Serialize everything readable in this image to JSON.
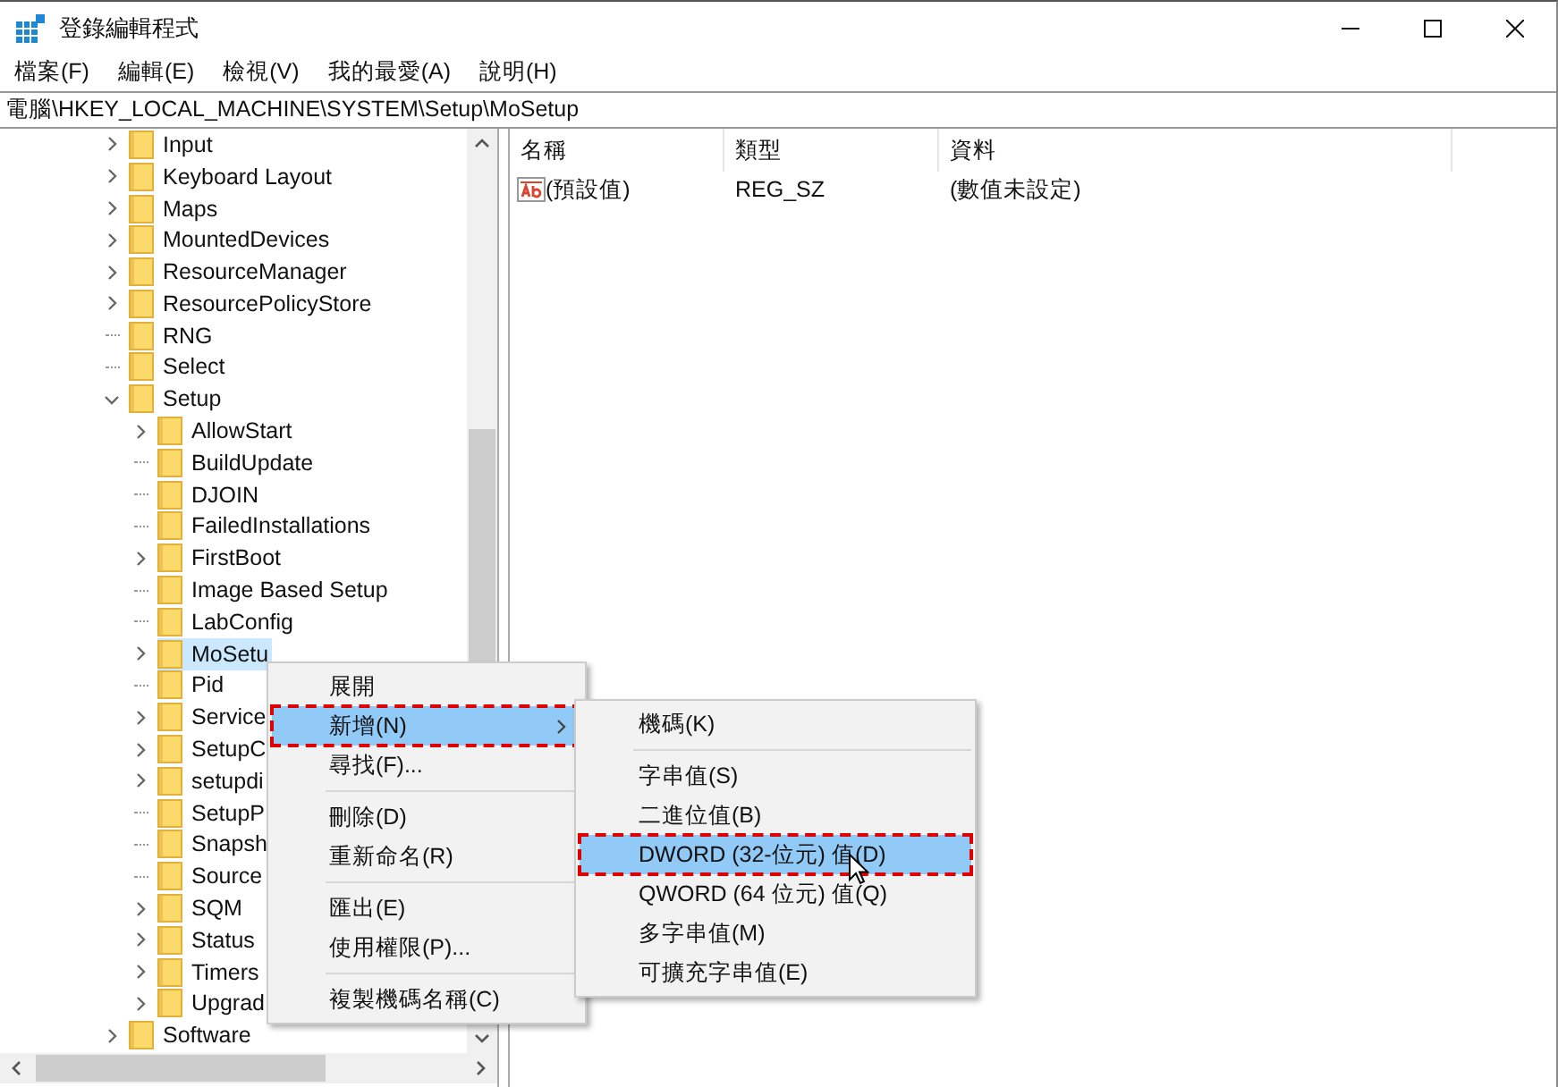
{
  "window": {
    "title": "登錄編輯程式"
  },
  "menu": [
    "檔案(F)",
    "編輯(E)",
    "檢視(V)",
    "我的最愛(A)",
    "說明(H)"
  ],
  "address": "電腦\\HKEY_LOCAL_MACHINE\\SYSTEM\\Setup\\MoSetup",
  "tree": [
    {
      "label": "Input",
      "has_children": true,
      "expanded": false,
      "selected": false
    },
    {
      "label": "Keyboard Layout",
      "has_children": true,
      "expanded": false,
      "selected": false
    },
    {
      "label": "Maps",
      "has_children": true,
      "expanded": false,
      "selected": false
    },
    {
      "label": "MountedDevices",
      "has_children": true,
      "expanded": false,
      "selected": false
    },
    {
      "label": "ResourceManager",
      "has_children": true,
      "expanded": false,
      "selected": false
    },
    {
      "label": "ResourcePolicyStore",
      "has_children": true,
      "expanded": false,
      "selected": false
    },
    {
      "label": "RNG",
      "has_children": false,
      "selected": false
    },
    {
      "label": "Select",
      "has_children": false,
      "selected": false
    },
    {
      "label": "Setup",
      "has_children": true,
      "expanded": true,
      "selected": false,
      "children": [
        {
          "label": "AllowStart",
          "has_children": true,
          "expanded": false,
          "selected": false
        },
        {
          "label": "BuildUpdate",
          "has_children": false,
          "selected": false
        },
        {
          "label": "DJOIN",
          "has_children": false,
          "selected": false
        },
        {
          "label": "FailedInstallations",
          "has_children": false,
          "selected": false
        },
        {
          "label": "FirstBoot",
          "has_children": true,
          "expanded": false,
          "selected": false
        },
        {
          "label": "Image Based Setup",
          "has_children": false,
          "selected": false
        },
        {
          "label": "LabConfig",
          "has_children": false,
          "selected": false
        },
        {
          "label": "MoSetu",
          "has_children": true,
          "expanded": false,
          "selected": true
        },
        {
          "label": "Pid",
          "has_children": false,
          "selected": false
        },
        {
          "label": "Service",
          "has_children": true,
          "expanded": false,
          "selected": false
        },
        {
          "label": "SetupC",
          "has_children": true,
          "expanded": false,
          "selected": false
        },
        {
          "label": "setupdi",
          "has_children": true,
          "expanded": false,
          "selected": false
        },
        {
          "label": "SetupP",
          "has_children": false,
          "selected": false
        },
        {
          "label": "Snapsh",
          "has_children": false,
          "selected": false
        },
        {
          "label": "Source",
          "has_children": false,
          "selected": false
        },
        {
          "label": "SQM",
          "has_children": true,
          "expanded": false,
          "selected": false
        },
        {
          "label": "Status",
          "has_children": true,
          "expanded": false,
          "selected": false
        },
        {
          "label": "Timers",
          "has_children": true,
          "expanded": false,
          "selected": false
        },
        {
          "label": "Upgrad",
          "has_children": true,
          "expanded": false,
          "selected": false
        }
      ]
    },
    {
      "label": "Software",
      "has_children": true,
      "expanded": false,
      "selected": false
    }
  ],
  "values": {
    "columns": [
      "名稱",
      "類型",
      "資料"
    ],
    "rows": [
      {
        "name": "(預設值)",
        "type": "REG_SZ",
        "data": "(數值未設定)"
      }
    ]
  },
  "context_menu": {
    "items": [
      {
        "kind": "item",
        "label": "展開",
        "selected": false
      },
      {
        "kind": "submenu",
        "label": "新增(N)",
        "selected": true
      },
      {
        "kind": "item",
        "label": "尋找(F)...",
        "selected": false
      },
      {
        "kind": "separator"
      },
      {
        "kind": "item",
        "label": "刪除(D)",
        "selected": false
      },
      {
        "kind": "item",
        "label": "重新命名(R)",
        "selected": false
      },
      {
        "kind": "separator"
      },
      {
        "kind": "item",
        "label": "匯出(E)",
        "selected": false
      },
      {
        "kind": "item",
        "label": "使用權限(P)...",
        "selected": false
      },
      {
        "kind": "separator"
      },
      {
        "kind": "item",
        "label": "複製機碼名稱(C)",
        "selected": false
      }
    ]
  },
  "submenu": {
    "items": [
      {
        "kind": "item",
        "label": "機碼(K)",
        "selected": false
      },
      {
        "kind": "separator"
      },
      {
        "kind": "item",
        "label": "字串值(S)",
        "selected": false
      },
      {
        "kind": "item",
        "label": "二進位值(B)",
        "selected": false
      },
      {
        "kind": "item",
        "label": "DWORD (32-位元) 值(D)",
        "selected": true
      },
      {
        "kind": "item",
        "label": "QWORD (64 位元) 值(Q)",
        "selected": false
      },
      {
        "kind": "item",
        "label": "多字串值(M)",
        "selected": false
      },
      {
        "kind": "item",
        "label": "可擴充字串值(E)",
        "selected": false
      }
    ]
  }
}
